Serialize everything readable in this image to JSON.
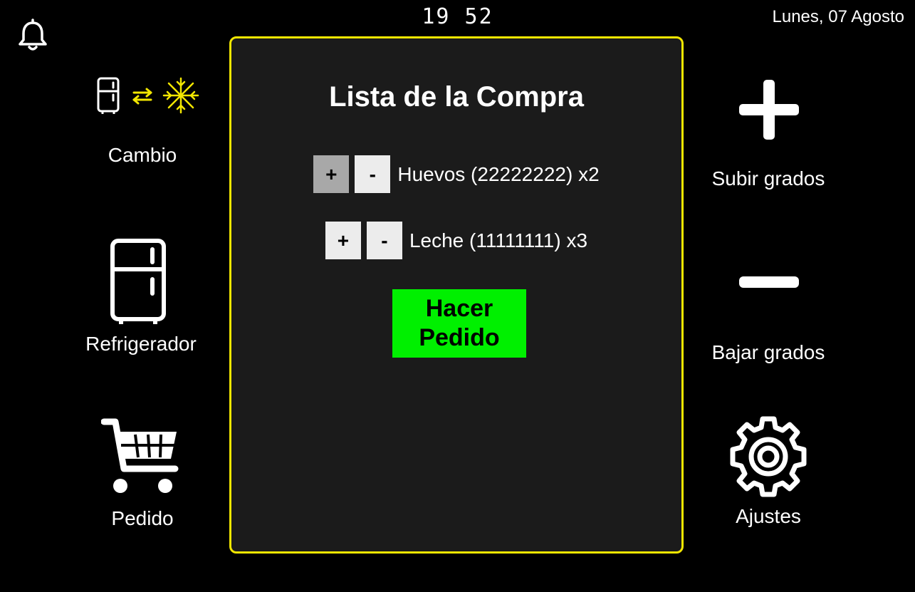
{
  "header": {
    "clock": "19 52",
    "date": "Lunes, 07 Agosto"
  },
  "left_menu": {
    "cambio_label": "Cambio",
    "refrigerador_label": "Refrigerador",
    "pedido_label": "Pedido"
  },
  "right_menu": {
    "subir_label": "Subir grados",
    "bajar_label": "Bajar grados",
    "ajustes_label": "Ajustes"
  },
  "panel": {
    "title": "Lista de la Compra",
    "items": [
      {
        "plus": "+",
        "minus": "-",
        "label": "Huevos (22222222) x2"
      },
      {
        "plus": "+",
        "minus": "-",
        "label": "Leche (11111111) x3"
      }
    ],
    "order_line1": "Hacer",
    "order_line2": "Pedido"
  },
  "colors": {
    "accent_yellow": "#f2e600",
    "order_green": "#00f000",
    "panel_bg": "#1b1b1b"
  },
  "icons": [
    "bell-icon",
    "fridge-swap-icon",
    "refrigerator-icon",
    "cart-icon",
    "plus-icon",
    "minus-icon",
    "gear-icon"
  ]
}
